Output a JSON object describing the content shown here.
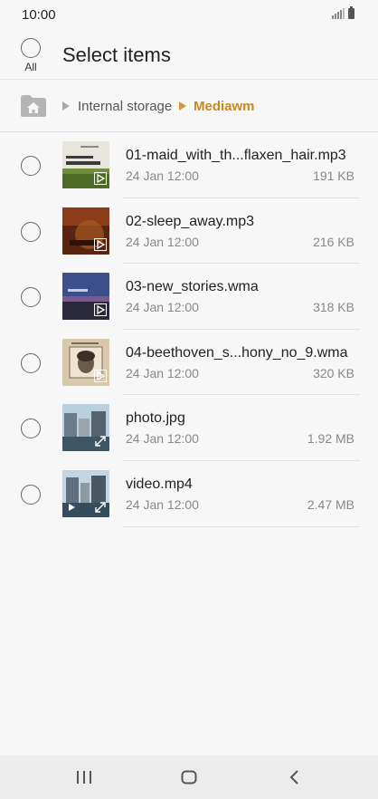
{
  "status_bar": {
    "time": "10:00"
  },
  "header": {
    "select_all_label": "All",
    "title": "Select items"
  },
  "breadcrumb": {
    "items": [
      "Internal storage",
      "Mediawm"
    ]
  },
  "files": [
    {
      "name": "01-maid_with_th...flaxen_hair.mp3",
      "date": "24 Jan 12:00",
      "size": "191 KB",
      "thumb": "album-richard-stoltzman"
    },
    {
      "name": "02-sleep_away.mp3",
      "date": "24 Jan 12:00",
      "size": "216 KB",
      "thumb": "album-sleep-away"
    },
    {
      "name": "03-new_stories.wma",
      "date": "24 Jan 12:00",
      "size": "318 KB",
      "thumb": "album-new-stories"
    },
    {
      "name": "04-beethoven_s...hony_no_9.wma",
      "date": "24 Jan 12:00",
      "size": "320 KB",
      "thumb": "album-beethoven"
    },
    {
      "name": "photo.jpg",
      "date": "24 Jan 12:00",
      "size": "1.92 MB",
      "thumb": "photo-harbour"
    },
    {
      "name": "video.mp4",
      "date": "24 Jan 12:00",
      "size": "2.47 MB",
      "thumb": "video-harbour"
    }
  ],
  "colors": {
    "accent": "#c98a1c",
    "background": "#f7f7f7",
    "divider": "#e2e2e2"
  },
  "nav_bar": {
    "icons": [
      "recents-icon",
      "home-icon",
      "back-icon"
    ]
  }
}
